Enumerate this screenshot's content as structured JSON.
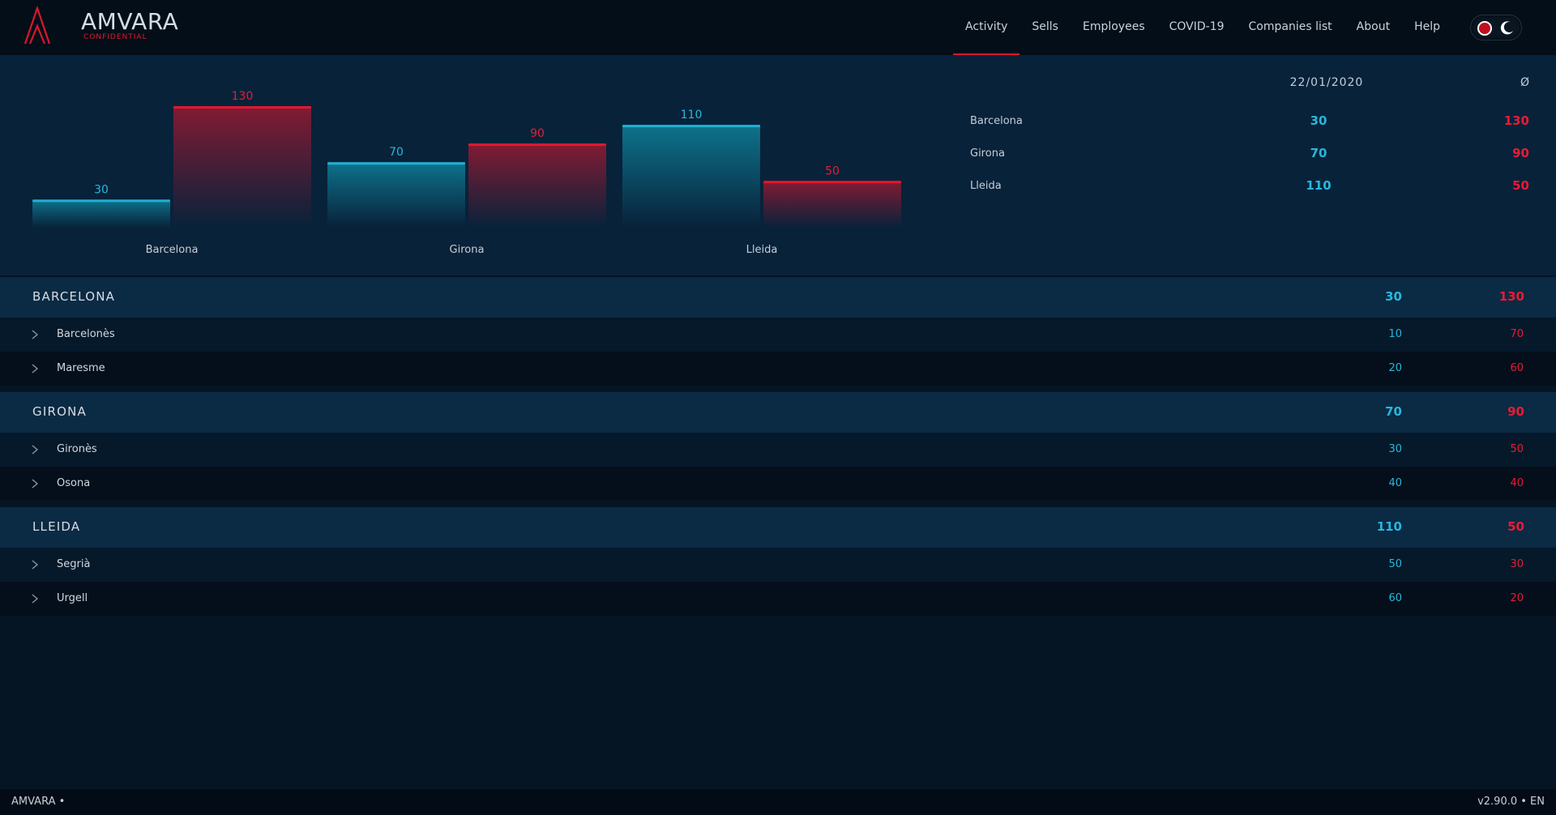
{
  "app": {
    "brand": "AMVARA",
    "brand_sub": "CONFIDENTIAL"
  },
  "nav": {
    "items": [
      "Activity",
      "Sells",
      "Employees",
      "COVID-19",
      "Companies list",
      "About",
      "Help"
    ],
    "active": "Activity"
  },
  "colors": {
    "accent_cyan": "#27b8dc",
    "accent_red": "#e81b35"
  },
  "chart_data": {
    "type": "bar",
    "categories": [
      "Barcelona",
      "Girona",
      "Lleida"
    ],
    "series": [
      {
        "values": [
          30,
          70,
          110
        ],
        "color": "#1a8fb0"
      },
      {
        "values": [
          130,
          90,
          50
        ],
        "color": "#b01529"
      }
    ],
    "ylim": [
      0,
      130
    ],
    "title": "",
    "xlabel": "",
    "ylabel": ""
  },
  "summary": {
    "date": "22/01/2020",
    "avg_symbol": "Ø",
    "rows": [
      {
        "name": "Barcelona",
        "v1": "30",
        "v2": "130"
      },
      {
        "name": "Girona",
        "v1": "70",
        "v2": "90"
      },
      {
        "name": "Lleida",
        "v1": "110",
        "v2": "50"
      }
    ]
  },
  "table": {
    "groups": [
      {
        "label": "BARCELONA",
        "v1": "30",
        "v2": "130",
        "subs": [
          {
            "label": "Barcelonès",
            "v1": "10",
            "v2": "70"
          },
          {
            "label": "Maresme",
            "v1": "20",
            "v2": "60"
          }
        ]
      },
      {
        "label": "GIRONA",
        "v1": "70",
        "v2": "90",
        "subs": [
          {
            "label": "Gironès",
            "v1": "30",
            "v2": "50"
          },
          {
            "label": "Osona",
            "v1": "40",
            "v2": "40"
          }
        ]
      },
      {
        "label": "LLEIDA",
        "v1": "110",
        "v2": "50",
        "subs": [
          {
            "label": "Segrià",
            "v1": "50",
            "v2": "30"
          },
          {
            "label": "Urgell",
            "v1": "60",
            "v2": "20"
          }
        ]
      }
    ]
  },
  "footer": {
    "left": "AMVARA •",
    "right": "v2.90.0 • EN"
  }
}
